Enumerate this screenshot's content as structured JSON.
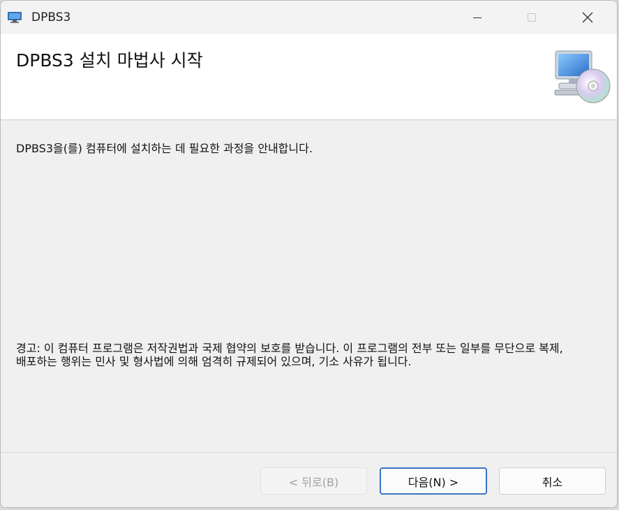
{
  "window": {
    "title": "DPBS3",
    "icon": "installer-app-icon"
  },
  "header": {
    "title": "DPBS3 설치 마법사 시작",
    "icon": "computer-cd-icon"
  },
  "body": {
    "intro": "DPBS3을(를) 컴퓨터에 설치하는 데 필요한 과정을 안내합니다.",
    "warning": "경고: 이 컴퓨터 프로그램은 저작권법과 국제 협약의 보호를 받습니다. 이 프로그램의 전부 또는 일부를 무단으로 복제, 배포하는 행위는 민사 및 형사법에 의해 엄격히 규제되어 있으며, 기소 사유가 됩니다."
  },
  "buttons": {
    "back": "< 뒤로(B)",
    "next": "다음(N) >",
    "cancel": "취소"
  },
  "colors": {
    "accent": "#3a73c4",
    "header_bg": "#ffffff",
    "body_bg": "#f0f0f0"
  }
}
